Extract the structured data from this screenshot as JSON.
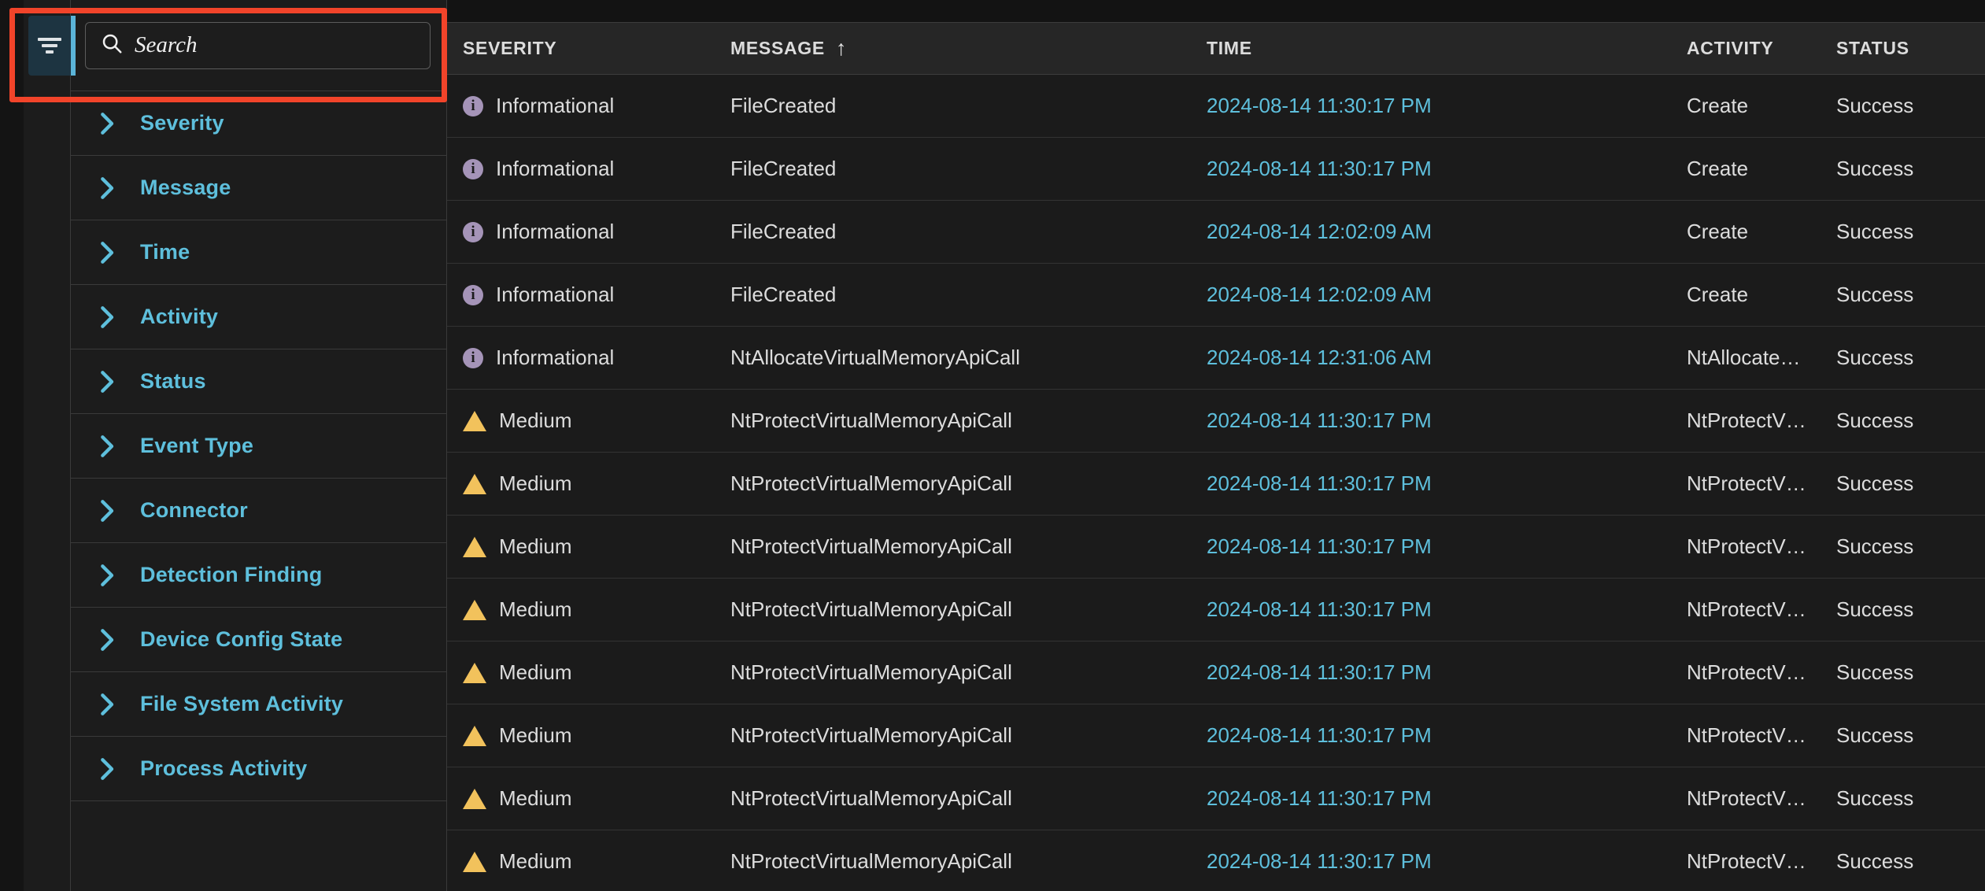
{
  "accent_colors": {
    "link_blue": "#5ebfdc",
    "highlight_red": "#f2442a",
    "rail_active_bg": "#1d3441",
    "rail_active_bar": "#5bb4d8",
    "severity_info": "#a594b8",
    "severity_medium": "#f2c25c"
  },
  "filter_rail": {
    "icon": "filter-funnel-icon",
    "active": true
  },
  "search": {
    "icon": "search-icon",
    "placeholder": "Search",
    "value": ""
  },
  "filters": {
    "chevron_icon": "chevron-right-icon",
    "items": [
      {
        "label": "Severity"
      },
      {
        "label": "Message"
      },
      {
        "label": "Time"
      },
      {
        "label": "Activity"
      },
      {
        "label": "Status"
      },
      {
        "label": "Event Type"
      },
      {
        "label": "Connector"
      },
      {
        "label": "Detection Finding"
      },
      {
        "label": "Device Config State"
      },
      {
        "label": "File System Activity"
      },
      {
        "label": "Process Activity"
      }
    ]
  },
  "table": {
    "columns": [
      {
        "key": "severity",
        "label": "SEVERITY",
        "sorted": false,
        "sort_icon": ""
      },
      {
        "key": "message",
        "label": "MESSAGE",
        "sorted": true,
        "sort_icon": "↑"
      },
      {
        "key": "time",
        "label": "TIME",
        "sorted": false,
        "sort_icon": ""
      },
      {
        "key": "activity",
        "label": "ACTIVITY",
        "sorted": false,
        "sort_icon": ""
      },
      {
        "key": "status",
        "label": "STATUS",
        "sorted": false,
        "sort_icon": ""
      }
    ],
    "rows": [
      {
        "severity": "Informational",
        "severity_icon": "info-circle-icon",
        "message": "FileCreated",
        "time": "2024-08-14 11:30:17 PM",
        "activity": "Create",
        "status": "Success"
      },
      {
        "severity": "Informational",
        "severity_icon": "info-circle-icon",
        "message": "FileCreated",
        "time": "2024-08-14 11:30:17 PM",
        "activity": "Create",
        "status": "Success"
      },
      {
        "severity": "Informational",
        "severity_icon": "info-circle-icon",
        "message": "FileCreated",
        "time": "2024-08-14 12:02:09 AM",
        "activity": "Create",
        "status": "Success"
      },
      {
        "severity": "Informational",
        "severity_icon": "info-circle-icon",
        "message": "FileCreated",
        "time": "2024-08-14 12:02:09 AM",
        "activity": "Create",
        "status": "Success"
      },
      {
        "severity": "Informational",
        "severity_icon": "info-circle-icon",
        "message": "NtAllocateVirtualMemoryApiCall",
        "time": "2024-08-14 12:31:06 AM",
        "activity": "NtAllocate…",
        "status": "Success"
      },
      {
        "severity": "Medium",
        "severity_icon": "warning-triangle-icon",
        "message": "NtProtectVirtualMemoryApiCall",
        "time": "2024-08-14 11:30:17 PM",
        "activity": "NtProtectV…",
        "status": "Success"
      },
      {
        "severity": "Medium",
        "severity_icon": "warning-triangle-icon",
        "message": "NtProtectVirtualMemoryApiCall",
        "time": "2024-08-14 11:30:17 PM",
        "activity": "NtProtectV…",
        "status": "Success"
      },
      {
        "severity": "Medium",
        "severity_icon": "warning-triangle-icon",
        "message": "NtProtectVirtualMemoryApiCall",
        "time": "2024-08-14 11:30:17 PM",
        "activity": "NtProtectV…",
        "status": "Success"
      },
      {
        "severity": "Medium",
        "severity_icon": "warning-triangle-icon",
        "message": "NtProtectVirtualMemoryApiCall",
        "time": "2024-08-14 11:30:17 PM",
        "activity": "NtProtectV…",
        "status": "Success"
      },
      {
        "severity": "Medium",
        "severity_icon": "warning-triangle-icon",
        "message": "NtProtectVirtualMemoryApiCall",
        "time": "2024-08-14 11:30:17 PM",
        "activity": "NtProtectV…",
        "status": "Success"
      },
      {
        "severity": "Medium",
        "severity_icon": "warning-triangle-icon",
        "message": "NtProtectVirtualMemoryApiCall",
        "time": "2024-08-14 11:30:17 PM",
        "activity": "NtProtectV…",
        "status": "Success"
      },
      {
        "severity": "Medium",
        "severity_icon": "warning-triangle-icon",
        "message": "NtProtectVirtualMemoryApiCall",
        "time": "2024-08-14 11:30:17 PM",
        "activity": "NtProtectV…",
        "status": "Success"
      },
      {
        "severity": "Medium",
        "severity_icon": "warning-triangle-icon",
        "message": "NtProtectVirtualMemoryApiCall",
        "time": "2024-08-14 11:30:17 PM",
        "activity": "NtProtectV…",
        "status": "Success"
      }
    ]
  }
}
